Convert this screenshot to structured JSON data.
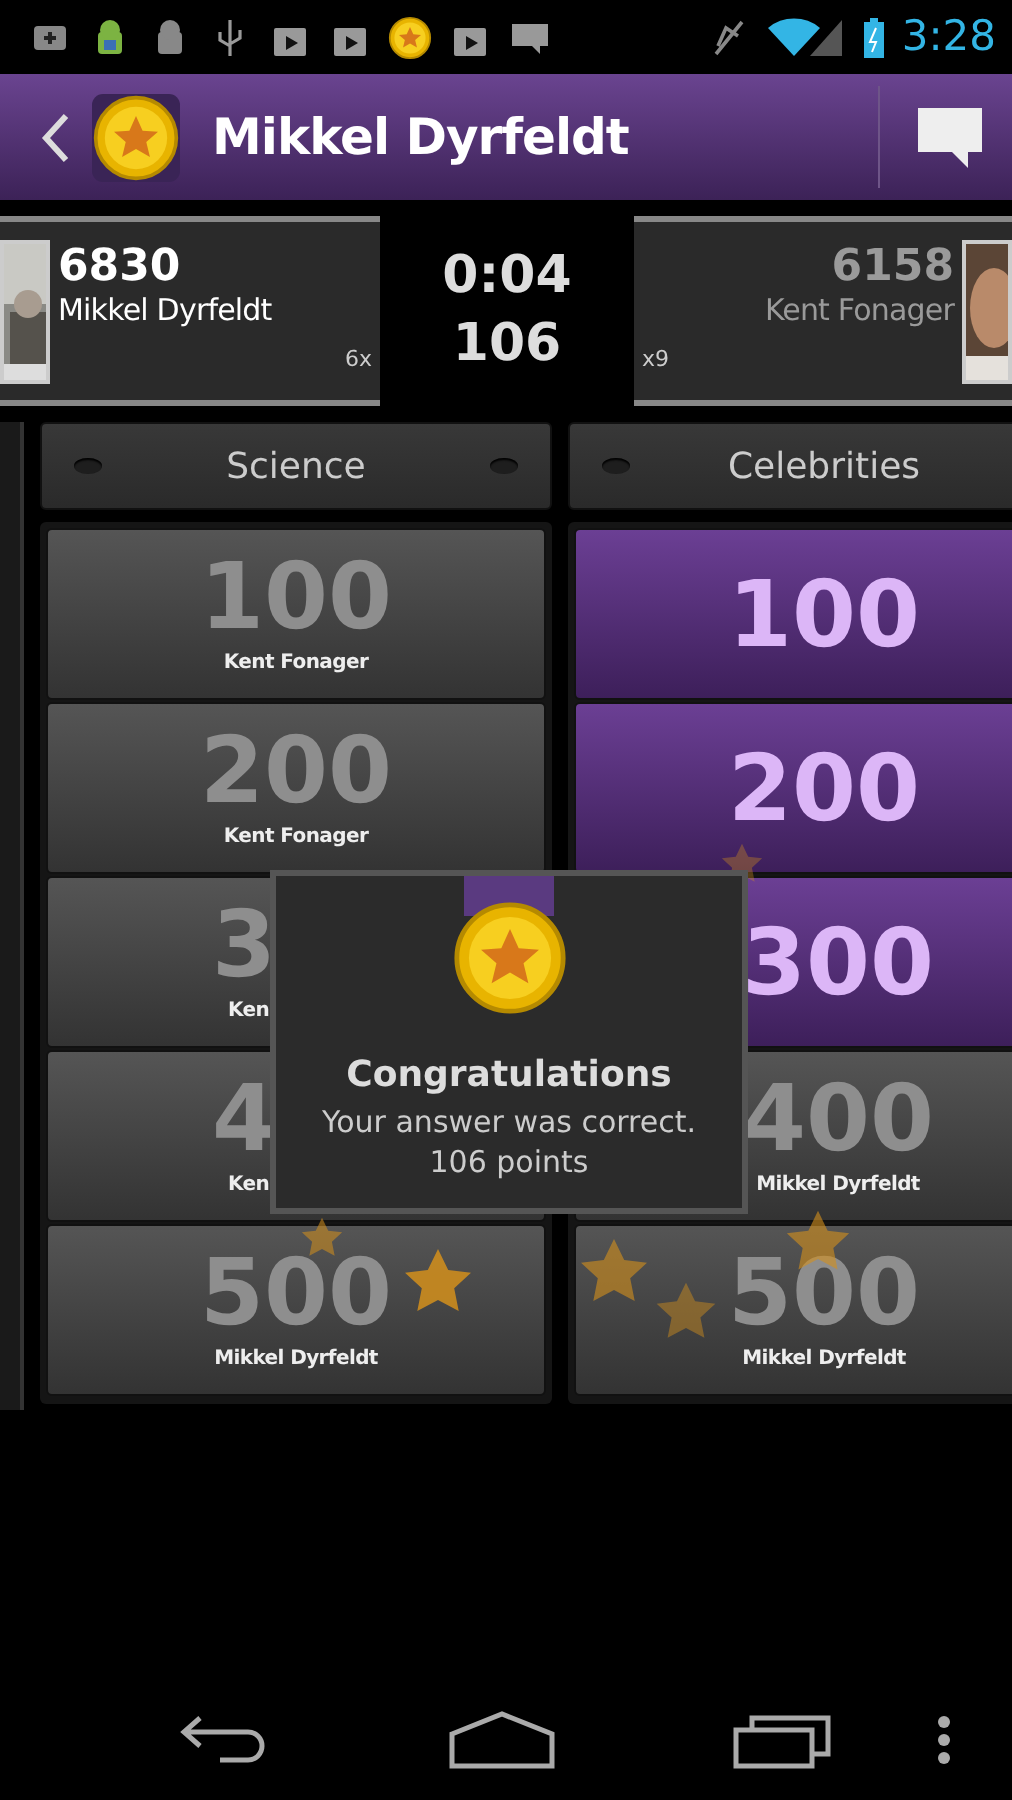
{
  "status_bar": {
    "time": "3:28"
  },
  "action_bar": {
    "title": "Mikkel Dyrfeldt"
  },
  "players": [
    {
      "kind": "left",
      "score": "6830",
      "name": "Mikkel Dyrfeldt",
      "multiplier": "6x",
      "active": true
    },
    {
      "kind": "right",
      "score": "6158",
      "name": "Kent Fonager",
      "multiplier": "x9",
      "active": false
    }
  ],
  "timer": {
    "time": "0:04",
    "points": "106"
  },
  "categories": [
    {
      "title": "Science",
      "tiles": [
        {
          "kind": "full",
          "value": "100",
          "owner": "Kent Fonager",
          "answered": true
        },
        {
          "kind": "full",
          "value": "200",
          "owner": "Kent Fonager",
          "answered": true
        },
        {
          "kind": "left_part",
          "value": "3",
          "owner": "Ken",
          "answered": true
        },
        {
          "kind": "left_part",
          "value": "4",
          "owner": "Ken",
          "answered": true
        },
        {
          "kind": "full",
          "value": "500",
          "owner": "Mikkel Dyrfeldt",
          "answered": true
        }
      ]
    },
    {
      "title": "Celebrities",
      "tiles": [
        {
          "kind": "full",
          "value": "100",
          "answered": false
        },
        {
          "kind": "full",
          "value": "200",
          "answered": false
        },
        {
          "kind": "right_part",
          "value": "300",
          "answered": false
        },
        {
          "kind": "right_part",
          "value": "400",
          "owner": "Mikkel Dyrfeldt",
          "answered": true
        },
        {
          "kind": "full",
          "value": "500",
          "owner": "Mikkel Dyrfeldt",
          "answered": true
        }
      ]
    }
  ],
  "dialog": {
    "title": "Congratulations",
    "message": "Your answer was correct.",
    "points": "106 points"
  }
}
